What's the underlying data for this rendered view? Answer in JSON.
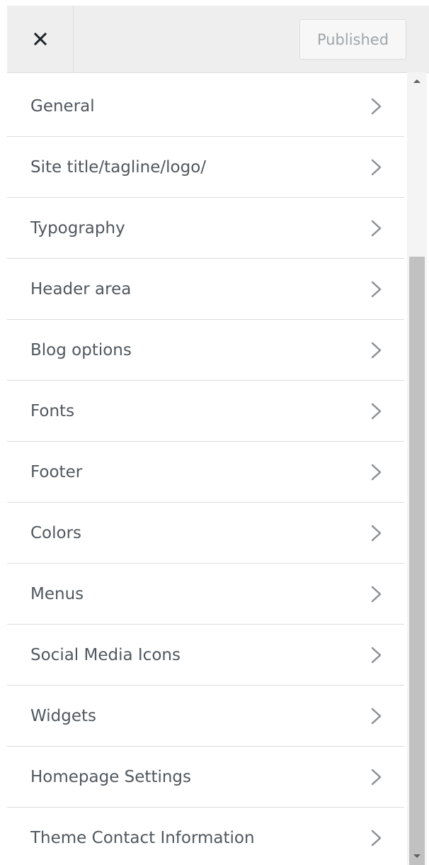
{
  "header": {
    "close_icon": "close-icon",
    "publish_label": "Published"
  },
  "menu": {
    "items": [
      {
        "label": "General"
      },
      {
        "label": "Site title/tagline/logo/"
      },
      {
        "label": "Typography"
      },
      {
        "label": "Header area"
      },
      {
        "label": "Blog options"
      },
      {
        "label": "Fonts"
      },
      {
        "label": "Footer"
      },
      {
        "label": "Colors"
      },
      {
        "label": "Menus"
      },
      {
        "label": "Social Media Icons"
      },
      {
        "label": "Widgets"
      },
      {
        "label": "Homepage Settings"
      },
      {
        "label": "Theme Contact Information"
      }
    ],
    "chevron_icon": "chevron-right-icon"
  },
  "colors": {
    "header_bg": "#eeeeee",
    "label_text": "#50575e",
    "chevron": "#8c8f94",
    "divider": "#dcdcde",
    "scroll_thumb": "#c1c1c1"
  }
}
